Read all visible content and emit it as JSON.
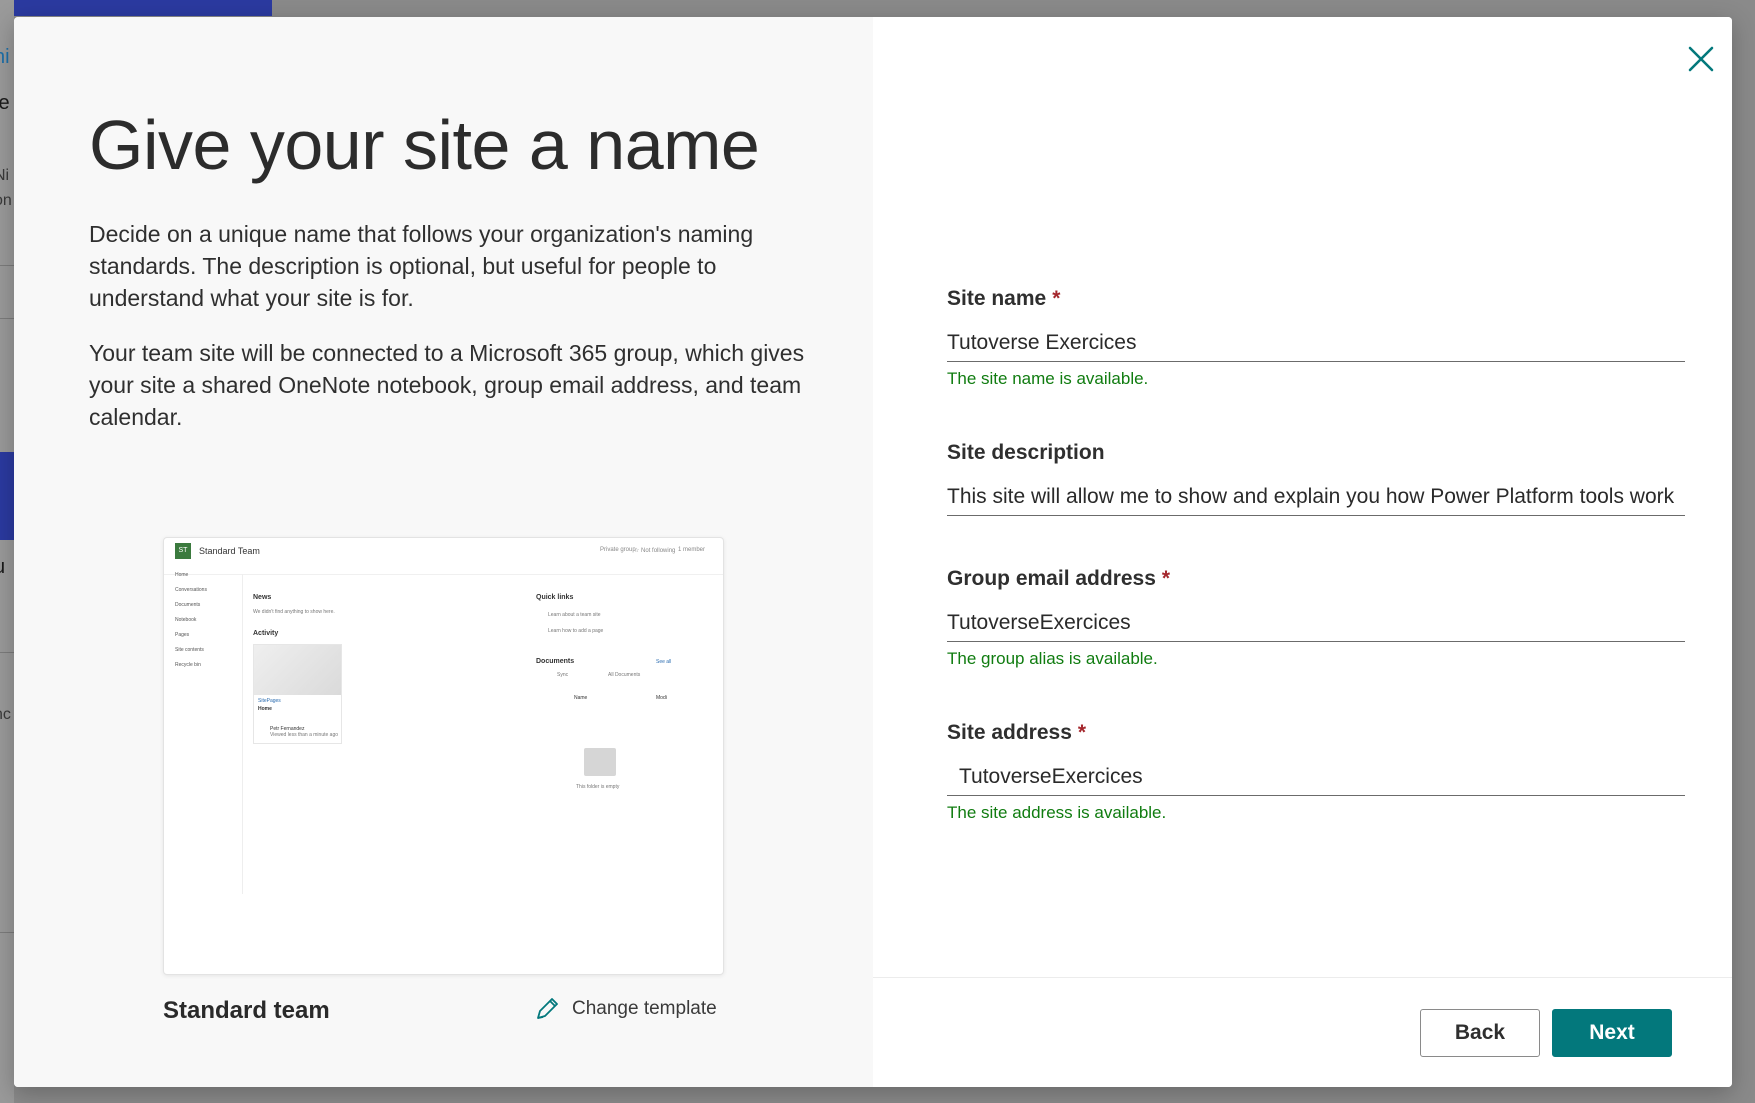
{
  "background": {
    "fragments": [
      "ni",
      "ie",
      "Ni",
      "on",
      "u",
      "nc"
    ]
  },
  "dialog": {
    "title": "Give your site a name",
    "description_1": "Decide on a unique name that follows your organization's naming standards. The description is optional, but useful for people to understand what your site is for.",
    "description_2": "Your team site will be connected to a Microsoft 365 group, which gives your site a shared OneNote notebook, group email address, and team calendar.",
    "preview": {
      "site_title": "Standard Team",
      "meta_private": "Private group",
      "meta_following": "☆ Not following",
      "meta_members": "1 member",
      "nav": [
        "Home",
        "Conversations",
        "Documents",
        "Notebook",
        "Pages",
        "Site contents",
        "Recycle bin"
      ],
      "news_heading": "News",
      "news_text": "We didn't find anything to show here.",
      "activity_heading": "Activity",
      "card_link": "SitePages",
      "card_title": "Home",
      "card_author": "Petr Fernandez",
      "card_time": "Viewed less than a minute ago",
      "quicklinks_heading": "Quick links",
      "quicklinks": [
        "Learn about a team site",
        "Learn how to add a page"
      ],
      "documents_heading": "Documents",
      "see_all": "See all",
      "sync": "Sync",
      "all_documents": "All Documents",
      "col_name": "Name",
      "col_modified": "Modi",
      "empty_folder": "This folder is empty"
    },
    "template_name": "Standard team",
    "change_template": "Change template",
    "icons": {
      "close": "close-icon",
      "change_template": "pencil-icon"
    },
    "accent_color": "#03787c",
    "success_color": "#107c10",
    "required_color": "#a4262c"
  },
  "form": {
    "site_name": {
      "label": "Site name",
      "required": "*",
      "value": "Tutoverse Exercices",
      "status": "The site name is available."
    },
    "site_description": {
      "label": "Site description",
      "value": "This site will allow me to show and explain you how Power Platform tools work"
    },
    "group_email": {
      "label": "Group email address",
      "required": "*",
      "value": "TutoverseExercices",
      "status": "The group alias is available."
    },
    "site_address": {
      "label": "Site address",
      "required": "*",
      "value": "TutoverseExercices",
      "status": "The site address is available."
    }
  },
  "buttons": {
    "back": "Back",
    "next": "Next"
  }
}
